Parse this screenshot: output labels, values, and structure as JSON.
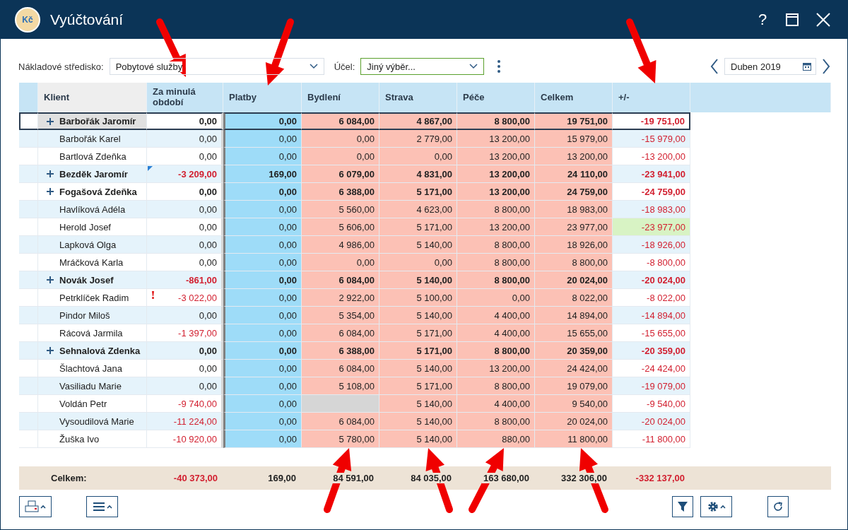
{
  "window": {
    "title": "Vyúčtování",
    "app_icon_text": "Kč",
    "help": "?"
  },
  "filters": {
    "cost_center_label": "Nákladové středisko:",
    "cost_center": "Pobytové služby",
    "purpose_label": "Účel:",
    "purpose": "Jiný výběr...",
    "period": "Duben 2019"
  },
  "table": {
    "columns": [
      "Klient",
      "Za minulá období",
      "Platby",
      "Bydlení",
      "Strava",
      "Péče",
      "Celkem",
      "+/-"
    ],
    "rows": [
      {
        "name": "Barbořák Jaromír",
        "group": true,
        "selected": true,
        "prev_negative": false,
        "diff_highlight": false,
        "prev": "0,00",
        "platby": "0,00",
        "bydleni": "6 084,00",
        "strava": "4 867,00",
        "pece": "8 800,00",
        "celkem": "19 751,00",
        "diff": "-19 751,00"
      },
      {
        "name": "Barbořák Karel",
        "group": false,
        "selected": false,
        "prev_negative": false,
        "diff_highlight": false,
        "prev": "0,00",
        "platby": "0,00",
        "bydleni": "0,00",
        "strava": "2 779,00",
        "pece": "13 200,00",
        "celkem": "15 979,00",
        "diff": "-15 979,00"
      },
      {
        "name": "Bartlová Zdeňka",
        "group": false,
        "selected": false,
        "prev_negative": false,
        "diff_highlight": false,
        "prev": "0,00",
        "platby": "0,00",
        "bydleni": "0,00",
        "strava": "0,00",
        "pece": "13 200,00",
        "celkem": "13 200,00",
        "diff": "-13 200,00"
      },
      {
        "name": "Bezděk Jaromír",
        "group": true,
        "selected": false,
        "prev_negative": true,
        "comment": true,
        "diff_highlight": false,
        "prev": "-3 209,00",
        "platby": "169,00",
        "bydleni": "6 079,00",
        "strava": "4 831,00",
        "pece": "13 200,00",
        "celkem": "24 110,00",
        "diff": "-23 941,00"
      },
      {
        "name": "Fogašová Zdeňka",
        "group": true,
        "selected": false,
        "prev_negative": false,
        "diff_highlight": false,
        "prev": "0,00",
        "platby": "0,00",
        "bydleni": "6 388,00",
        "strava": "5 171,00",
        "pece": "13 200,00",
        "celkem": "24 759,00",
        "diff": "-24 759,00"
      },
      {
        "name": "Havlíková Adéla",
        "group": false,
        "selected": false,
        "prev_negative": false,
        "diff_highlight": false,
        "prev": "0,00",
        "platby": "0,00",
        "bydleni": "5 560,00",
        "strava": "4 623,00",
        "pece": "8 800,00",
        "celkem": "18 983,00",
        "diff": "-18 983,00"
      },
      {
        "name": "Herold Josef",
        "group": false,
        "selected": false,
        "prev_negative": false,
        "diff_highlight": true,
        "prev": "0,00",
        "platby": "0,00",
        "bydleni": "5 606,00",
        "strava": "5 171,00",
        "pece": "13 200,00",
        "celkem": "23 977,00",
        "diff": "-23 977,00"
      },
      {
        "name": "Lapková Olga",
        "group": false,
        "selected": false,
        "prev_negative": false,
        "diff_highlight": false,
        "prev": "0,00",
        "platby": "0,00",
        "bydleni": "4 986,00",
        "strava": "5 140,00",
        "pece": "8 800,00",
        "celkem": "18 926,00",
        "diff": "-18 926,00"
      },
      {
        "name": "Mráčková Karla",
        "group": false,
        "selected": false,
        "prev_negative": false,
        "diff_highlight": false,
        "prev": "0,00",
        "platby": "0,00",
        "bydleni": "0,00",
        "strava": "0,00",
        "pece": "8 800,00",
        "celkem": "8 800,00",
        "diff": "-8 800,00"
      },
      {
        "name": "Novák Josef",
        "group": true,
        "selected": false,
        "prev_negative": true,
        "diff_highlight": false,
        "prev": "-861,00",
        "platby": "0,00",
        "bydleni": "6 084,00",
        "strava": "5 140,00",
        "pece": "8 800,00",
        "celkem": "20 024,00",
        "diff": "-20 024,00"
      },
      {
        "name": "Petrklíček Radim",
        "group": false,
        "selected": false,
        "prev_negative": true,
        "alert": true,
        "diff_highlight": false,
        "prev": "-3 022,00",
        "platby": "0,00",
        "bydleni": "2 922,00",
        "strava": "5 100,00",
        "pece": "0,00",
        "celkem": "8 022,00",
        "diff": "-8 022,00"
      },
      {
        "name": "Pindor Miloš",
        "group": false,
        "selected": false,
        "prev_negative": false,
        "diff_highlight": false,
        "prev": "0,00",
        "platby": "0,00",
        "bydleni": "5 354,00",
        "strava": "5 140,00",
        "pece": "4 400,00",
        "celkem": "14 894,00",
        "diff": "-14 894,00"
      },
      {
        "name": "Rácová Jarmila",
        "group": false,
        "selected": false,
        "prev_negative": true,
        "diff_highlight": false,
        "prev": "-1 397,00",
        "platby": "0,00",
        "bydleni": "6 084,00",
        "strava": "5 171,00",
        "pece": "4 400,00",
        "celkem": "15 655,00",
        "diff": "-15 655,00"
      },
      {
        "name": "Sehnalová Zdenka",
        "group": true,
        "selected": false,
        "prev_negative": false,
        "diff_highlight": false,
        "prev": "0,00",
        "platby": "0,00",
        "bydleni": "6 388,00",
        "strava": "5 171,00",
        "pece": "8 800,00",
        "celkem": "20 359,00",
        "diff": "-20 359,00"
      },
      {
        "name": "Šlachtová Jana",
        "group": false,
        "selected": false,
        "prev_negative": false,
        "diff_highlight": false,
        "prev": "0,00",
        "platby": "0,00",
        "bydleni": "6 084,00",
        "strava": "5 140,00",
        "pece": "13 200,00",
        "celkem": "24 424,00",
        "diff": "-24 424,00"
      },
      {
        "name": "Vasiliadu Marie",
        "group": false,
        "selected": false,
        "prev_negative": false,
        "diff_highlight": false,
        "prev": "0,00",
        "platby": "0,00",
        "bydleni": "5 108,00",
        "strava": "5 171,00",
        "pece": "8 800,00",
        "celkem": "19 079,00",
        "diff": "-19 079,00"
      },
      {
        "name": "Voldán Petr",
        "group": false,
        "selected": false,
        "prev_negative": true,
        "diff_highlight": false,
        "prev": "-9 740,00",
        "platby": "0,00",
        "strava": "5 140,00",
        "pece": "4 400,00",
        "celkem": "9 540,00",
        "diff": "-9 540,00"
      },
      {
        "name": "Vysoudilová Marie",
        "group": false,
        "selected": false,
        "prev_negative": true,
        "diff_highlight": false,
        "prev": "-11 224,00",
        "platby": "0,00",
        "bydleni": "6 084,00",
        "strava": "5 140,00",
        "pece": "8 800,00",
        "celkem": "20 024,00",
        "diff": "-20 024,00"
      },
      {
        "name": "Žuška Ivo",
        "group": false,
        "selected": false,
        "prev_negative": true,
        "diff_highlight": false,
        "prev": "-10 920,00",
        "platby": "0,00",
        "bydleni": "5 780,00",
        "strava": "5 140,00",
        "pece": "880,00",
        "celkem": "11 800,00",
        "diff": "-11 800,00"
      }
    ],
    "total": {
      "label": "Celkem:",
      "values": [
        "-40 373,00",
        "169,00",
        "84 591,00",
        "84 035,00",
        "163 680,00",
        "332 306,00",
        "-332 137,00"
      ]
    }
  }
}
